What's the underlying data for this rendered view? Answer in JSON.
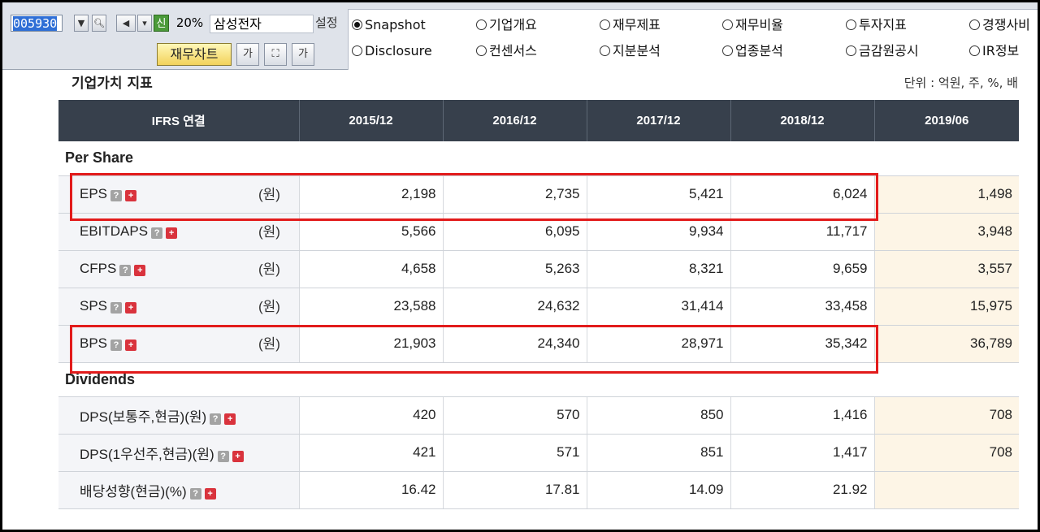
{
  "toolbar": {
    "stock_code": "005930",
    "percent": "20%",
    "stock_name": "삼성전자",
    "settings_label": "설정",
    "chart_button": "재무차트",
    "font_btn": "가",
    "font_btn2": "가"
  },
  "menu": {
    "options": [
      {
        "label": "Snapshot",
        "selected": true
      },
      {
        "label": "기업개요",
        "selected": false
      },
      {
        "label": "재무제표",
        "selected": false
      },
      {
        "label": "재무비율",
        "selected": false
      },
      {
        "label": "투자지표",
        "selected": false
      },
      {
        "label": "경쟁사비",
        "selected": false
      },
      {
        "label": "Disclosure",
        "selected": false
      },
      {
        "label": "컨센서스",
        "selected": false
      },
      {
        "label": "지분분석",
        "selected": false
      },
      {
        "label": "업종분석",
        "selected": false
      },
      {
        "label": "금감원공시",
        "selected": false
      },
      {
        "label": "IR정보",
        "selected": false
      }
    ]
  },
  "section": {
    "title": "기업가치 지표",
    "unit_note": "단위 : 억원, 주, %, 배"
  },
  "table": {
    "header": [
      "IFRS 연결",
      "2015/12",
      "2016/12",
      "2017/12",
      "2018/12",
      "2019/06"
    ],
    "groups": [
      {
        "name": "Per Share",
        "rows": [
          {
            "label": "EPS",
            "unit": "(원)",
            "values": [
              "2,198",
              "2,735",
              "5,421",
              "6,024",
              "1,498"
            ]
          },
          {
            "label": "EBITDAPS",
            "unit": "(원)",
            "values": [
              "5,566",
              "6,095",
              "9,934",
              "11,717",
              "3,948"
            ]
          },
          {
            "label": "CFPS",
            "unit": "(원)",
            "values": [
              "4,658",
              "5,263",
              "8,321",
              "9,659",
              "3,557"
            ]
          },
          {
            "label": "SPS",
            "unit": "(원)",
            "values": [
              "23,588",
              "24,632",
              "31,414",
              "33,458",
              "15,975"
            ]
          },
          {
            "label": "BPS",
            "unit": "(원)",
            "values": [
              "21,903",
              "24,340",
              "28,971",
              "35,342",
              "36,789"
            ]
          }
        ]
      },
      {
        "name": "Dividends",
        "rows": [
          {
            "label": "DPS(보통주,현금)(원)",
            "unit": "",
            "values": [
              "420",
              "570",
              "850",
              "1,416",
              "708"
            ]
          },
          {
            "label": "DPS(1우선주,현금)(원)",
            "unit": "",
            "values": [
              "421",
              "571",
              "851",
              "1,417",
              "708"
            ]
          },
          {
            "label": "배당성향(현금)(%)",
            "unit": "",
            "values": [
              "16.42",
              "17.81",
              "14.09",
              "21.92",
              ""
            ]
          }
        ]
      }
    ]
  },
  "icons": {
    "question": "?",
    "plus": "+"
  },
  "highlight_color": "#e21b1b"
}
